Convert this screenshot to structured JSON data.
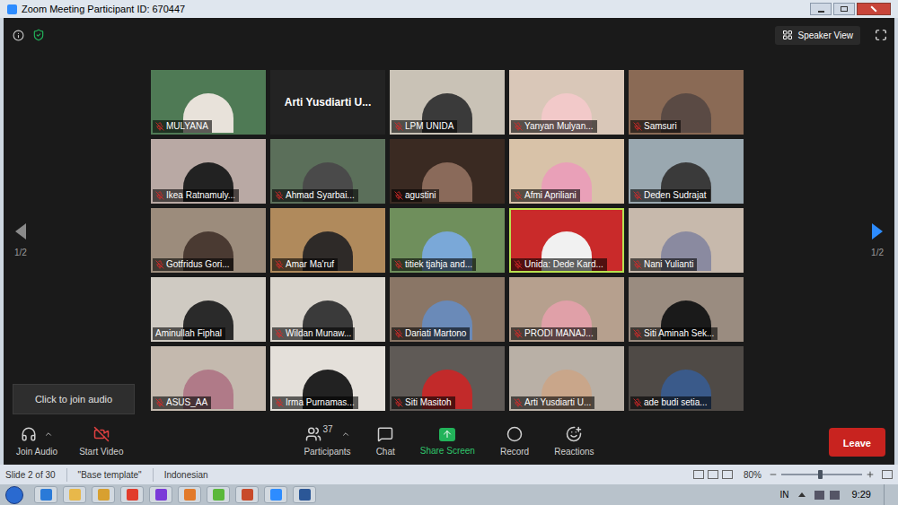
{
  "window": {
    "title": "Zoom Meeting Participant ID: 670447"
  },
  "top_bar": {
    "view_button": "Speaker View"
  },
  "pager": {
    "left": "1/2",
    "right": "1/2"
  },
  "participants": [
    {
      "name": "MULYANA",
      "kind": "video",
      "muted": true,
      "selected": false
    },
    {
      "name": "Arti Yusdiarti U...",
      "kind": "name",
      "muted": false,
      "selected": false
    },
    {
      "name": "LPM UNIDA",
      "kind": "video",
      "muted": true,
      "selected": false
    },
    {
      "name": "Yanyan Mulyan...",
      "kind": "video",
      "muted": true,
      "selected": false
    },
    {
      "name": "Samsuri",
      "kind": "video",
      "muted": true,
      "selected": false
    },
    {
      "name": "Ikea Ratnamuly...",
      "kind": "video",
      "muted": true,
      "selected": false
    },
    {
      "name": "Ahmad Syarbai...",
      "kind": "video",
      "muted": true,
      "selected": false
    },
    {
      "name": "agustini",
      "kind": "video",
      "muted": true,
      "selected": false
    },
    {
      "name": "Afmi Apriliani",
      "kind": "video",
      "muted": true,
      "selected": false
    },
    {
      "name": "Deden Sudrajat",
      "kind": "video",
      "muted": true,
      "selected": false
    },
    {
      "name": "Gotfridus Gori...",
      "kind": "video",
      "muted": true,
      "selected": false
    },
    {
      "name": "Amar Ma'ruf",
      "kind": "video",
      "muted": true,
      "selected": false
    },
    {
      "name": "titiek tjahja and...",
      "kind": "video",
      "muted": true,
      "selected": false
    },
    {
      "name": "Unida: Dede Kard...",
      "kind": "video",
      "muted": true,
      "selected": true
    },
    {
      "name": "Nani Yulianti",
      "kind": "video",
      "muted": true,
      "selected": false
    },
    {
      "name": "Aminullah Fiphal",
      "kind": "video",
      "muted": false,
      "selected": false
    },
    {
      "name": "Wildan Munaw...",
      "kind": "video",
      "muted": true,
      "selected": false
    },
    {
      "name": "Dariati Martono",
      "kind": "video",
      "muted": true,
      "selected": false
    },
    {
      "name": "PRODI MANAJ...",
      "kind": "video",
      "muted": true,
      "selected": false
    },
    {
      "name": "Siti Aminah Sek...",
      "kind": "video",
      "muted": true,
      "selected": false
    },
    {
      "name": "ASUS_AA",
      "kind": "video",
      "muted": true,
      "selected": false
    },
    {
      "name": "Irma Purnamas...",
      "kind": "video",
      "muted": true,
      "selected": false
    },
    {
      "name": "Siti Masitoh",
      "kind": "video",
      "muted": true,
      "selected": false
    },
    {
      "name": "Arti Yusdiarti U...",
      "kind": "video",
      "muted": true,
      "selected": false
    },
    {
      "name": "ade budi setia...",
      "kind": "video",
      "muted": true,
      "selected": false
    }
  ],
  "tooltip": "Click to join audio",
  "toolbar": {
    "left": [
      {
        "label": "Join Audio",
        "kind": "audio"
      },
      {
        "label": "Start Video",
        "kind": "video"
      }
    ],
    "center": [
      {
        "label": "Participants",
        "kind": "participants",
        "count": "37"
      },
      {
        "label": "Chat",
        "kind": "chat"
      },
      {
        "label": "Share Screen",
        "kind": "share"
      },
      {
        "label": "Record",
        "kind": "record"
      },
      {
        "label": "Reactions",
        "kind": "reactions"
      }
    ],
    "leave": "Leave"
  },
  "status_bar": {
    "slide": "Slide 2 of 30",
    "template": "\"Base template\"",
    "language": "Indonesian",
    "zoom": "80%",
    "zoom_level": 0.45
  },
  "taskbar": {
    "language": "IN",
    "time": "9:29"
  }
}
